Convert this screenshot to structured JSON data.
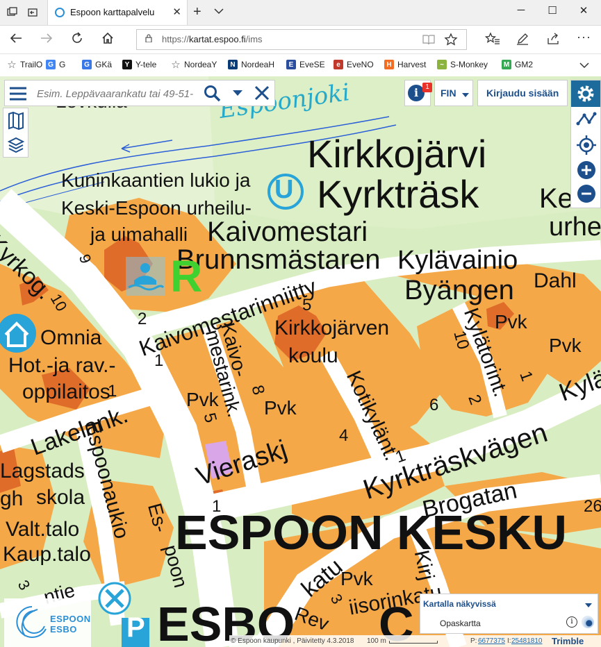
{
  "browser": {
    "tab_title": "Espoon karttapalvelu",
    "url_prefix": "https://",
    "url_host": "kartat.espoo.fi",
    "url_path": "/ims",
    "bookmarks": [
      {
        "label": "TrailO",
        "icon": "star-icon",
        "color": "#555555"
      },
      {
        "label": "G",
        "icon": "google-icon",
        "color": "#4285f4"
      },
      {
        "label": "GKä",
        "icon": "translate-icon",
        "color": "#3b78e7"
      },
      {
        "label": "Y-tele",
        "icon": "yle-icon",
        "color": "#111111"
      },
      {
        "label": "NordeaY",
        "icon": "star-icon",
        "color": "#555555"
      },
      {
        "label": "NordeaH",
        "icon": "nordea-icon",
        "color": "#0a3c78"
      },
      {
        "label": "EveSE",
        "icon": "eve-icon",
        "color": "#2b4f9e"
      },
      {
        "label": "EveNO",
        "icon": "eve-no-icon",
        "color": "#c0392b"
      },
      {
        "label": "Harvest",
        "icon": "harvest-icon",
        "color": "#f36c21"
      },
      {
        "label": "S-Monkey",
        "icon": "monkey-icon",
        "color": "#8cb33e"
      },
      {
        "label": "GM2",
        "icon": "maps-icon",
        "color": "#34a853"
      }
    ]
  },
  "app": {
    "search_placeholder": "Esim. Leppävaarankatu tai 49-51-",
    "info_badge": "1",
    "language": "FIN",
    "login_label": "Kirjaudu sisään",
    "layer_panel_title": "Kartalla näkyvissä",
    "layer_name": "Opaskartta",
    "logo_line1": "ESPOON",
    "logo_line2": "ESBO",
    "footer_copyright": "© Espoon kaupunki , Päivitetty 4.3.2018",
    "scale_label": "100 m",
    "coord_p_label": "P:",
    "coord_p": "6677375",
    "coord_i_label": "I:",
    "coord_i": "25481810",
    "trimble": "Trimble"
  },
  "map": {
    "colors": {
      "grass": "#d9edc2",
      "building": "#f5a848",
      "building_dark": "#e06c2a",
      "road": "#ffffff",
      "water_line": "#2a5fd8",
      "water_text": "#27a9c9"
    },
    "labels": {
      "espoonjoki": "Espoonjoki",
      "lovkulla": "Lovkulla",
      "kirkkojarvi": "Kirkkojärvi",
      "kyrktrask": "Kyrkträsk",
      "ke": "Ke",
      "urhe": "urhe",
      "lukio1": "Kuninkaantien lukio ja",
      "lukio2": "Keski-Espoon urheilu-",
      "lukio3": "ja uimahalli",
      "kaivomestari": "Kaivomestari",
      "brunnsmastaren": "Brunnsmästaren",
      "kylavainio": "Kylävainio",
      "byangen": "Byängen",
      "dahl": "Dahl",
      "kyrkog": "Kyrkog.",
      "kaivomestarinniitty": "Kaivomestarinniitty",
      "kaivomestarink": "Kaivo-",
      "mestarink": "mestarink.",
      "kirkkojarven": "Kirkkojärven",
      "koulu": "koulu",
      "kotikylant": "Kotikylänt.",
      "kylatorint": "Kylätorint.",
      "kyla": "Kylä",
      "omnia": "Omnia",
      "hot": "Hot.-ja rav.-",
      "oppilaitos": "oppilaitos",
      "lakelank": "Lakelank.",
      "espoonaukio": "Espoonaukio",
      "vieraskj": "Vieraskj",
      "kyrktraskvagen": "Kyrkträskvägen",
      "lagstads": "Lagstads",
      "skola": "skola",
      "gh": "gh",
      "valt": "Valt.talo",
      "kaup": "Kaup.talo",
      "es": "Es-",
      "poon": "poon",
      "espoon_keskus": "ESPOON KESKU",
      "esbo": "ESBO",
      "esbo_c": "C",
      "brogatan": "Brogatan",
      "katu": "katu",
      "kirj": "Kirj",
      "rev": "Rev",
      "iisorinkatu": "iisorinkatu",
      "ntie": "ntie",
      "pvk": "Pvk",
      "u": "U",
      "r": "R",
      "p": "P",
      "n_2": "2",
      "n_1": "1",
      "n_3": "3",
      "n_4": "4",
      "n_5": "5",
      "n_6": "6",
      "n_8": "8",
      "n_9": "9",
      "n_10": "10",
      "n_26": "26"
    }
  }
}
